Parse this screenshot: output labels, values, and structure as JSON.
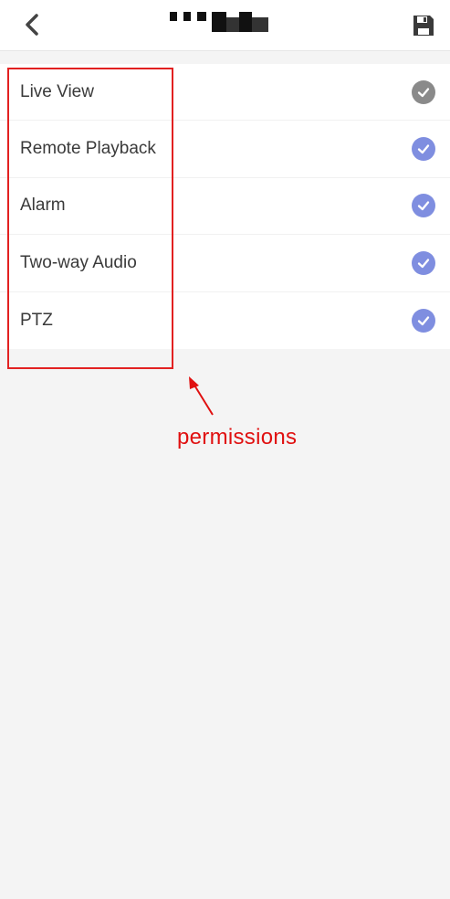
{
  "header": {
    "back_icon": "chevron-left-icon",
    "save_icon": "floppy-disk-icon"
  },
  "colors": {
    "accent": "#7f8ee0",
    "disabled_check": "#8a8a8a",
    "annotation": "#e01010"
  },
  "permissions": [
    {
      "label": "Live View",
      "checked_style": "gray"
    },
    {
      "label": "Remote Playback",
      "checked_style": "accent"
    },
    {
      "label": "Alarm",
      "checked_style": "accent"
    },
    {
      "label": "Two-way Audio",
      "checked_style": "accent"
    },
    {
      "label": "PTZ",
      "checked_style": "accent"
    }
  ],
  "annotation": {
    "text": "permissions"
  }
}
